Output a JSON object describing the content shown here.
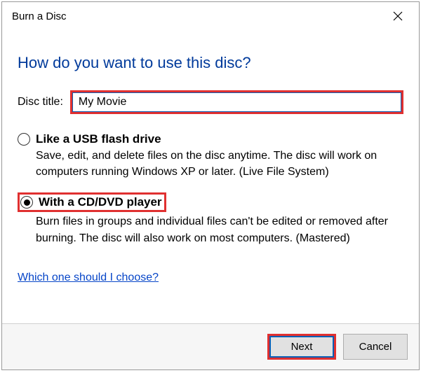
{
  "window": {
    "title": "Burn a Disc"
  },
  "heading": "How do you want to use this disc?",
  "discTitle": {
    "label": "Disc title:",
    "value": "My Movie"
  },
  "options": {
    "usb": {
      "title": "Like a USB flash drive",
      "desc": "Save, edit, and delete files on the disc anytime. The disc will work on computers running Windows XP or later. (Live File System)",
      "selected": false
    },
    "cddvd": {
      "title": "With a CD/DVD player",
      "desc": "Burn files in groups and individual files can't be edited or removed after burning. The disc will also work on most computers. (Mastered)",
      "selected": true
    }
  },
  "helpLink": "Which one should I choose?",
  "buttons": {
    "next": "Next",
    "cancel": "Cancel"
  },
  "colors": {
    "highlight": "#e03030",
    "headingBlue": "#003a9b",
    "focusBlue": "#0a5fb5",
    "link": "#0645c8"
  }
}
